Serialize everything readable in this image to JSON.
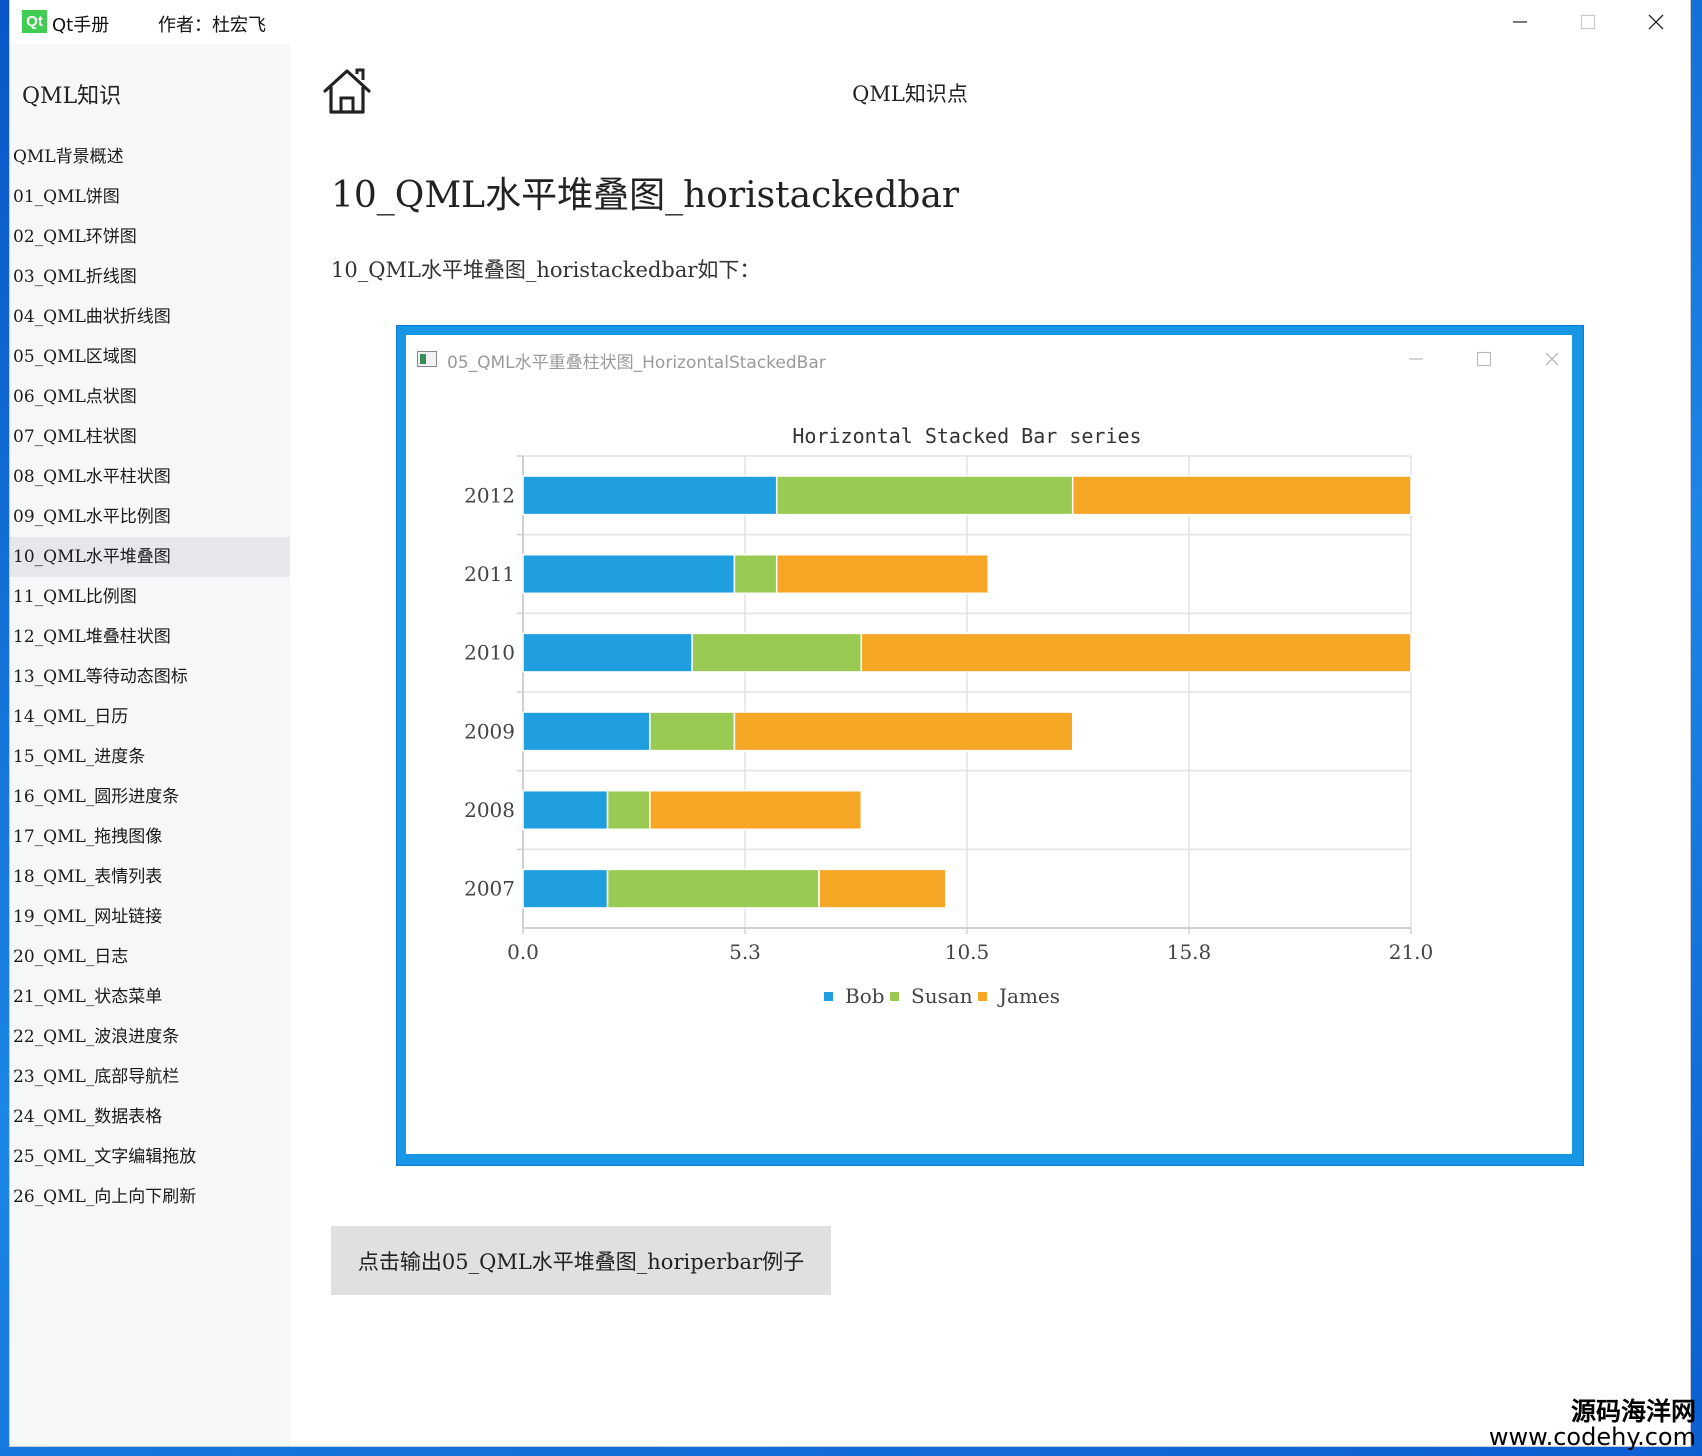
{
  "window": {
    "app_logo_text": "Qt",
    "app_title": "Qt手册",
    "author": "作者：杜宏飞"
  },
  "sidebar": {
    "title": "QML知识",
    "active_index": 10,
    "items": [
      {
        "label": "QML背景概述"
      },
      {
        "label": "01_QML饼图"
      },
      {
        "label": "02_QML环饼图"
      },
      {
        "label": "03_QML折线图"
      },
      {
        "label": "04_QML曲状折线图"
      },
      {
        "label": "05_QML区域图"
      },
      {
        "label": "06_QML点状图"
      },
      {
        "label": "07_QML柱状图"
      },
      {
        "label": "08_QML水平柱状图"
      },
      {
        "label": "09_QML水平比例图"
      },
      {
        "label": "10_QML水平堆叠图"
      },
      {
        "label": "11_QML比例图"
      },
      {
        "label": "12_QML堆叠柱状图"
      },
      {
        "label": "13_QML等待动态图标"
      },
      {
        "label": "14_QML_日历"
      },
      {
        "label": "15_QML_进度条"
      },
      {
        "label": "16_QML_圆形进度条"
      },
      {
        "label": "17_QML_拖拽图像"
      },
      {
        "label": "18_QML_表情列表"
      },
      {
        "label": "19_QML_网址链接"
      },
      {
        "label": "20_QML_日志"
      },
      {
        "label": "21_QML_状态菜单"
      },
      {
        "label": "22_QML_波浪进度条"
      },
      {
        "label": "23_QML_底部导航栏"
      },
      {
        "label": "24_QML_数据表格"
      },
      {
        "label": "25_QML_文字编辑拖放"
      },
      {
        "label": "26_QML_向上向下刷新"
      }
    ]
  },
  "header": {
    "home_icon": "home-icon",
    "title": "QML知识点"
  },
  "content": {
    "page_title": "10_QML水平堆叠图_horistackedbar",
    "intro": "10_QML水平堆叠图_horistackedbar如下：",
    "screenshot_window_title": "05_QML水平重叠柱状图_HorizontalStackedBar",
    "button_label": "点击输出05_QML水平堆叠图_horiperbar例子"
  },
  "chart_data": {
    "type": "bar",
    "orientation": "horizontal",
    "stacked": true,
    "title": "Horizontal Stacked Bar series",
    "categories": [
      "2007",
      "2008",
      "2009",
      "2010",
      "2011",
      "2012"
    ],
    "series": [
      {
        "name": "Bob",
        "color": "#209fdf",
        "values": [
          2,
          2,
          3,
          4,
          5,
          6
        ]
      },
      {
        "name": "Susan",
        "color": "#99ca53",
        "values": [
          5,
          1,
          2,
          4,
          1,
          7
        ]
      },
      {
        "name": "James",
        "color": "#f6a625",
        "values": [
          3,
          5,
          8,
          13,
          5,
          8
        ]
      }
    ],
    "x_ticks": [
      "0.0",
      "5.3",
      "10.5",
      "15.8",
      "21.0"
    ],
    "xlim": [
      0,
      21
    ],
    "grid": true,
    "legend_position": "bottom"
  },
  "watermark": {
    "cn": "源码海洋网",
    "url": "www.codehy.com"
  }
}
